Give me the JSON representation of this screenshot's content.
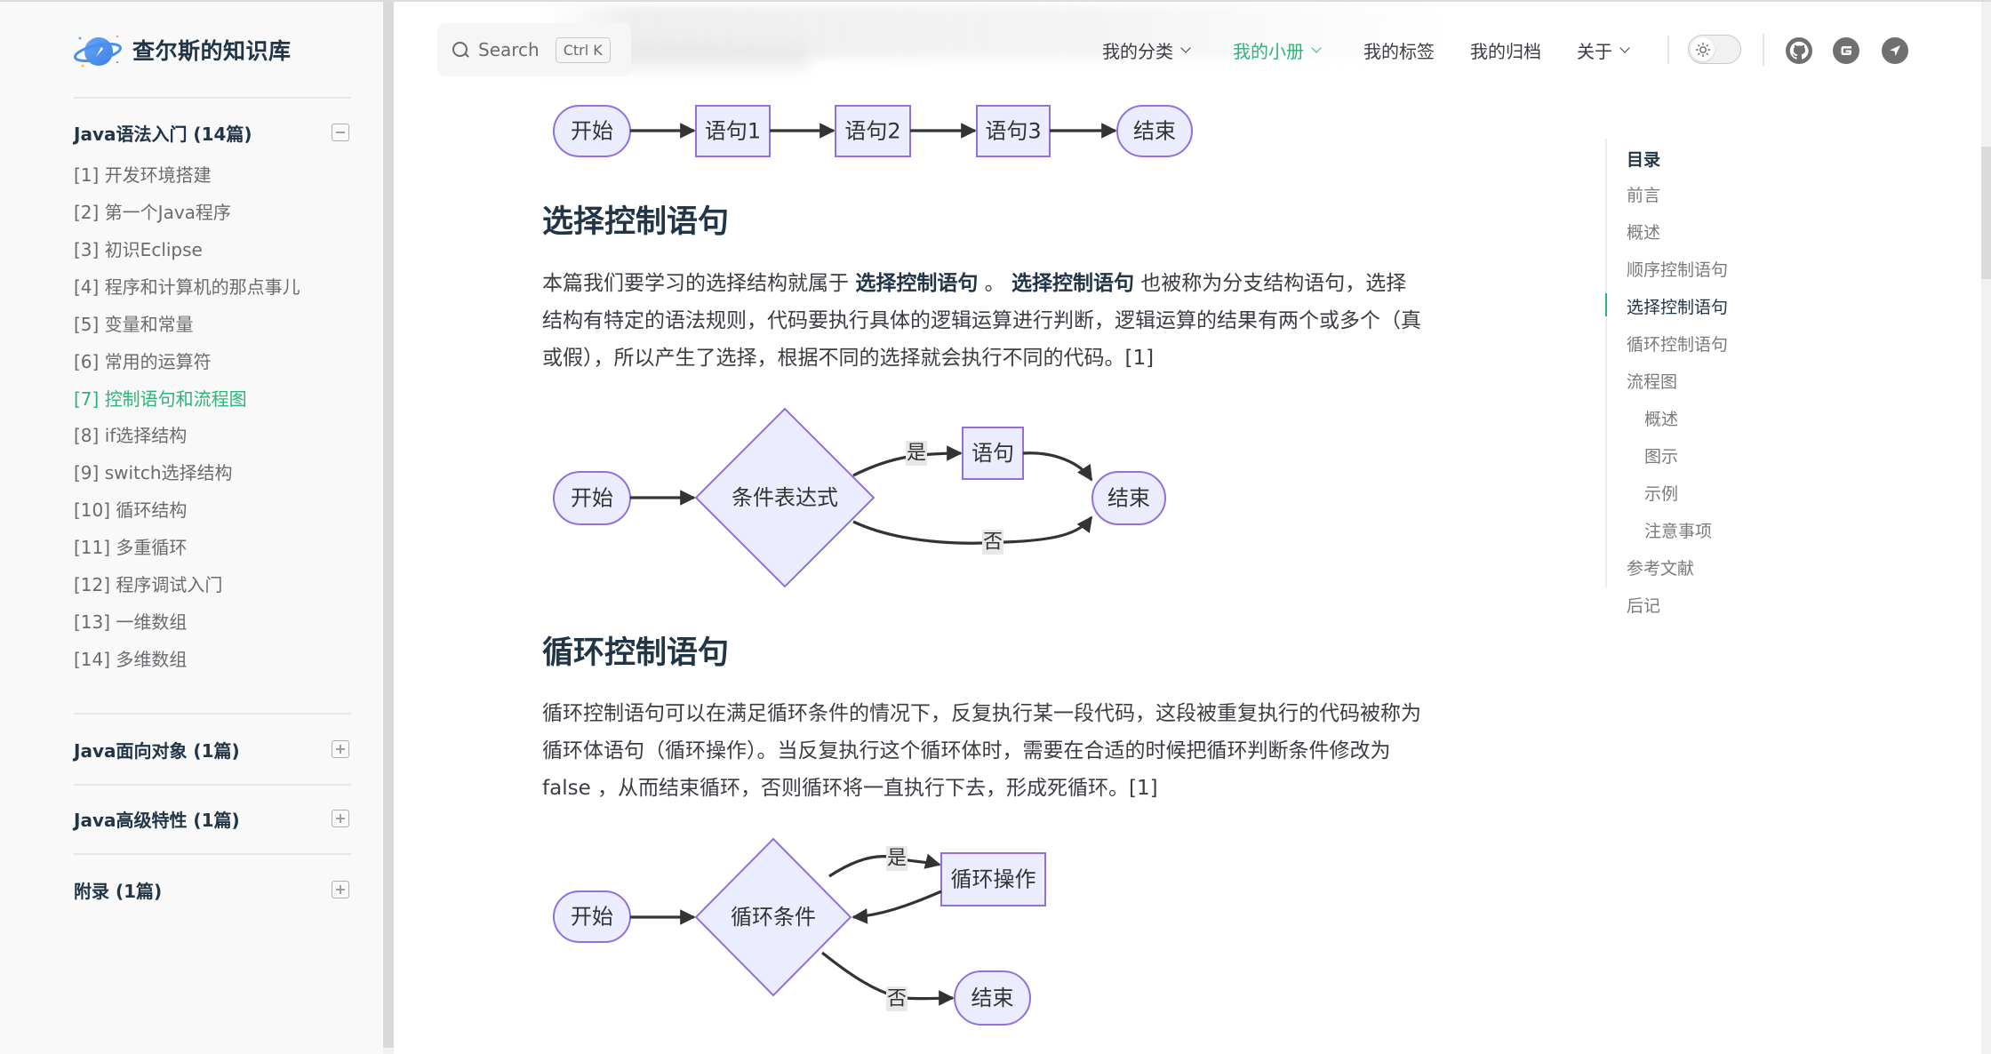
{
  "site": {
    "title": "查尔斯的知识库",
    "logo": "planet-rocket-logo"
  },
  "search": {
    "label": "Search",
    "shortcut": "Ctrl K"
  },
  "nav": {
    "items": [
      {
        "label": "我的分类",
        "dropdown": true,
        "active": false
      },
      {
        "label": "我的小册",
        "dropdown": true,
        "active": true
      },
      {
        "label": "我的标签",
        "dropdown": false,
        "active": false
      },
      {
        "label": "我的归档",
        "dropdown": false,
        "active": false
      },
      {
        "label": "关于",
        "dropdown": true,
        "active": false
      }
    ],
    "theme_toggle": {
      "icon": "sun-icon",
      "mode": "light"
    },
    "social": [
      {
        "name": "github-icon"
      },
      {
        "name": "gitee-icon",
        "glyph": "G"
      },
      {
        "name": "send-icon"
      }
    ]
  },
  "sidebar": {
    "groups": [
      {
        "label": "Java语法入门 (14篇)",
        "expanded": true,
        "items": [
          {
            "label": "[1] 开发环境搭建"
          },
          {
            "label": "[2] 第一个Java程序"
          },
          {
            "label": "[3] 初识Eclipse"
          },
          {
            "label": "[4] 程序和计算机的那点事儿"
          },
          {
            "label": "[5] 变量和常量"
          },
          {
            "label": "[6] 常用的运算符"
          },
          {
            "label": "[7] 控制语句和流程图",
            "active": true
          },
          {
            "label": "[8] if选择结构"
          },
          {
            "label": "[9] switch选择结构"
          },
          {
            "label": "[10] 循环结构"
          },
          {
            "label": "[11] 多重循环"
          },
          {
            "label": "[12] 程序调试入门"
          },
          {
            "label": "[13] 一维数组"
          },
          {
            "label": "[14] 多维数组"
          }
        ]
      },
      {
        "label": "Java面向对象 (1篇)",
        "expanded": false
      },
      {
        "label": "Java高级特性 (1篇)",
        "expanded": false
      },
      {
        "label": "附录 (1篇)",
        "expanded": false
      }
    ]
  },
  "content": {
    "sequence_diagram": {
      "nodes": [
        "开始",
        "语句1",
        "语句2",
        "语句3",
        "结束"
      ]
    },
    "section_select": {
      "heading": "选择控制语句",
      "lines": [
        {
          "pre": "本篇我们要学习的选择结构就属于 ",
          "b1": "选择控制语句",
          "mid": " 。 ",
          "b2": "选择控制语句",
          "post": " 也被称为分支结构语句，选择"
        },
        {
          "text": "结构有特定的语法规则，代码要执行具体的逻辑运算进行判断，逻辑运算的结果有两个或多个（真"
        },
        {
          "text": "或假），所以产生了选择，根据不同的选择就会执行不同的代码。[1]"
        }
      ],
      "diagram": {
        "start": "开始",
        "condition": "条件表达式",
        "statement": "语句",
        "end": "结束",
        "yes": "是",
        "no": "否"
      }
    },
    "section_loop": {
      "heading": "循环控制语句",
      "lines": [
        "循环控制语句可以在满足循环条件的情况下，反复执行某一段代码，这段被重复执行的代码被称为",
        "循环体语句（循环操作）。当反复执行这个循环体时，需要在合适的时候把循环判断条件修改为",
        "false ，从而结束循环，否则循环将一直执行下去，形成死循环。[1]"
      ],
      "diagram": {
        "start": "开始",
        "condition": "循环条件",
        "operation": "循环操作",
        "end": "结束",
        "yes": "是",
        "no": "否"
      }
    }
  },
  "toc": {
    "title": "目录",
    "items": [
      {
        "label": "前言",
        "level": 1
      },
      {
        "label": "概述",
        "level": 1
      },
      {
        "label": "顺序控制语句",
        "level": 1
      },
      {
        "label": "选择控制语句",
        "level": 1,
        "active": true
      },
      {
        "label": "循环控制语句",
        "level": 1
      },
      {
        "label": "流程图",
        "level": 1
      },
      {
        "label": "概述",
        "level": 2
      },
      {
        "label": "图示",
        "level": 2
      },
      {
        "label": "示例",
        "level": 2
      },
      {
        "label": "注意事项",
        "level": 2
      },
      {
        "label": "参考文献",
        "level": 1
      },
      {
        "label": "后记",
        "level": 1
      }
    ]
  },
  "colors": {
    "accent": "#2fb37a",
    "node_fill": "#ececff",
    "node_stroke": "#9370db",
    "edge": "#333333",
    "heading": "#213547",
    "text": "#3c3c43"
  }
}
